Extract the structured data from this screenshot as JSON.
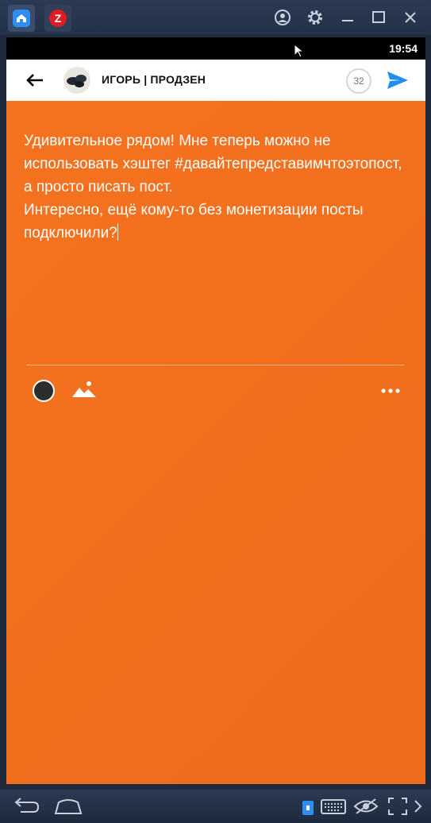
{
  "window": {
    "tabs": [
      {
        "icon": "home-icon"
      },
      {
        "icon": "zen-app-icon",
        "glyph": "Z"
      }
    ],
    "controls": [
      "account-icon",
      "gear-icon",
      "minimize-icon",
      "maximize-icon",
      "close-icon"
    ]
  },
  "status_bar": {
    "time": "19:54"
  },
  "app_bar": {
    "channel_name": "ИГОРЬ | ПРОДЗЕН",
    "counter": "32"
  },
  "post": {
    "text": "Удивительное рядом! Мне теперь можно не использовать хэштег #давайтепредставимчтоэтопост, а просто писать пост.\nИнтересно, ещё кому-то без монетизации посты подключили?",
    "background_color": "#f26f1e"
  },
  "toolbar": {
    "tools": [
      "background-color-icon",
      "image-icon",
      "more-icon"
    ]
  },
  "nav_bar": {
    "icons": [
      "back-icon",
      "home-icon",
      "lock-icon",
      "keyboard-icon",
      "eye-icon",
      "fullscreen-icon",
      "chevron-right-icon"
    ]
  },
  "colors": {
    "accent": "#1e8ef2",
    "editor_bg": "#f26f1e",
    "frame": "#233149"
  }
}
